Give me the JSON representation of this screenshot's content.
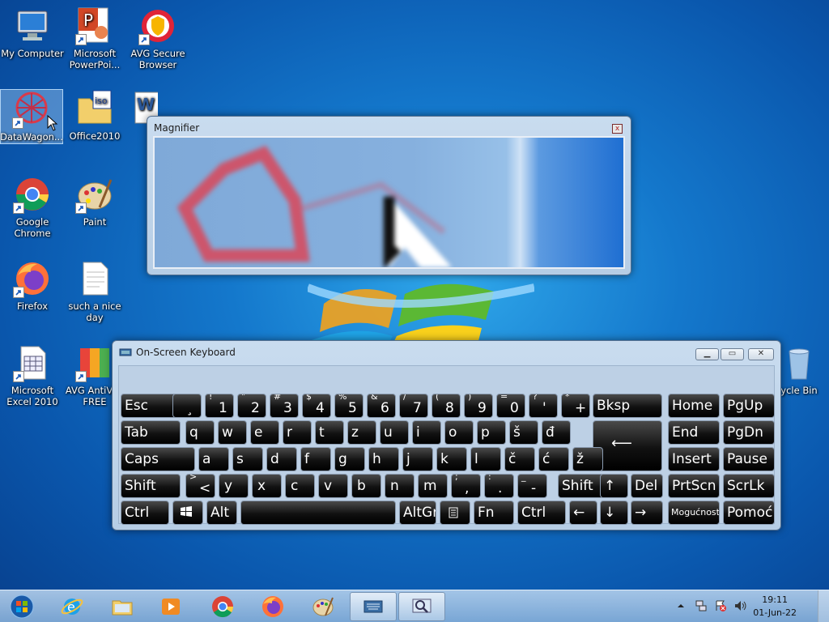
{
  "desktop": {
    "icons": [
      {
        "label": "My Computer"
      },
      {
        "label": "Microsoft PowerPoi..."
      },
      {
        "label": "AVG Secure Browser"
      },
      {
        "label": "DataWagon..."
      },
      {
        "label": "Office2010"
      },
      {
        "label": "Google Chrome"
      },
      {
        "label": "Paint"
      },
      {
        "label": "Firefox"
      },
      {
        "label": "such a nice day"
      },
      {
        "label": "Microsoft Excel 2010"
      },
      {
        "label": "AVG AntiVi... FREE"
      },
      {
        "label": "ycle Bin"
      }
    ]
  },
  "magnifier": {
    "title": "Magnifier",
    "close": "x"
  },
  "osk": {
    "title": "On-Screen Keyboard",
    "keys": {
      "esc": "Esc",
      "bksp": "Bksp",
      "home": "Home",
      "pgup": "PgUp",
      "tab": "Tab",
      "end": "End",
      "pgdn": "PgDn",
      "caps": "Caps",
      "insert": "Insert",
      "pause": "Pause",
      "shift": "Shift",
      "del": "Del",
      "prtscn": "PrtScn",
      "scrlk": "ScrLk",
      "ctrl": "Ctrl",
      "alt": "Alt",
      "altgr": "AltGr",
      "fn": "Fn",
      "mogucnosti": "Mogućnosti",
      "pomoc": "Pomoć",
      "row1": [
        {
          "sup": "¨",
          "main": "¸"
        },
        {
          "sup": "!",
          "main": "1"
        },
        {
          "sup": "\"",
          "main": "2"
        },
        {
          "sup": "#",
          "main": "3"
        },
        {
          "sup": "$",
          "main": "4"
        },
        {
          "sup": "%",
          "main": "5"
        },
        {
          "sup": "&",
          "main": "6"
        },
        {
          "sup": "/",
          "main": "7"
        },
        {
          "sup": "(",
          "main": "8"
        },
        {
          "sup": ")",
          "main": "9"
        },
        {
          "sup": "=",
          "main": "0"
        },
        {
          "sup": "?",
          "main": "'"
        },
        {
          "sup": "*",
          "main": "+"
        }
      ],
      "row2": [
        "q",
        "w",
        "e",
        "r",
        "t",
        "z",
        "u",
        "i",
        "o",
        "p",
        "š",
        "đ"
      ],
      "row3": [
        "a",
        "s",
        "d",
        "f",
        "g",
        "h",
        "j",
        "k",
        "l",
        "č",
        "ć",
        "ž"
      ],
      "row4": [
        {
          "sup": ">",
          "main": "<"
        },
        {
          "main": "y"
        },
        {
          "main": "x"
        },
        {
          "main": "c"
        },
        {
          "main": "v"
        },
        {
          "main": "b"
        },
        {
          "main": "n"
        },
        {
          "main": "m"
        },
        {
          "sup": ";",
          "main": ","
        },
        {
          "sup": ":",
          "main": "."
        },
        {
          "sup": "_",
          "main": "-"
        }
      ],
      "arrows": {
        "up": "↑",
        "left": "←",
        "down": "↓",
        "right": "→"
      }
    }
  },
  "taskbar": {
    "time": "19:11",
    "date": "01-Jun-22"
  },
  "colors": {
    "accent": "#1478cc",
    "key": "#111111"
  }
}
